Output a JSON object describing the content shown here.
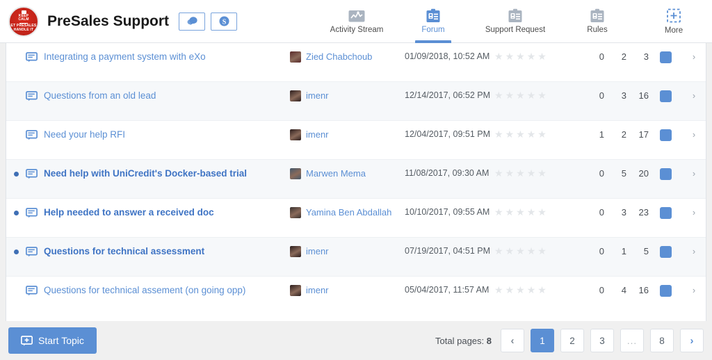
{
  "header": {
    "logo": {
      "line1": "KEEP",
      "line2": "CALM",
      "line3": "ET PRESALES",
      "line4": "HANDLE IT"
    },
    "title": "PreSales Support",
    "buttons": [
      {
        "name": "chat-button",
        "icon": "chat-bubble-icon"
      },
      {
        "name": "skype-button",
        "icon": "skype-icon"
      }
    ],
    "nav": [
      {
        "label": "Activity Stream",
        "icon": "activity-chart-icon",
        "active": false
      },
      {
        "label": "Forum",
        "icon": "clipboard-icon",
        "active": true
      },
      {
        "label": "Support Request",
        "icon": "clipboard-icon",
        "active": false
      },
      {
        "label": "Rules",
        "icon": "clipboard-icon",
        "active": false
      },
      {
        "label": "More",
        "icon": "plus-dashed-icon",
        "active": false
      }
    ]
  },
  "colors": {
    "accent": "#5b8fd4",
    "link": "#5b8fd4",
    "logo_red": "#c0241a",
    "star_empty": "#e3e6e9",
    "row_alt": "#f6f8fa",
    "footer_bg": "#f0f0f0"
  },
  "topics": [
    {
      "unread": false,
      "icon": "forum-topic-icon",
      "title": "Integrating a payment system with eXo",
      "author": "Zied Chabchoub",
      "avatar_color": "#5a2b2b",
      "date": "01/09/2018, 10:52 AM",
      "rating": 0,
      "stars": 5,
      "n1": "0",
      "n2": "2",
      "n3": "3"
    },
    {
      "unread": false,
      "icon": "forum-topic-icon",
      "title": "Questions from an old lead",
      "author": "imenr",
      "avatar_color": "#2b1d1d",
      "date": "12/14/2017, 06:52 PM",
      "rating": 0,
      "stars": 5,
      "n1": "0",
      "n2": "3",
      "n3": "16"
    },
    {
      "unread": false,
      "icon": "forum-topic-icon",
      "title": "Need your help RFI",
      "author": "imenr",
      "avatar_color": "#2b1d1d",
      "date": "12/04/2017, 09:51 PM",
      "rating": 0,
      "stars": 5,
      "n1": "1",
      "n2": "2",
      "n3": "17"
    },
    {
      "unread": true,
      "icon": "forum-topic-icon",
      "title": "Need help with UniCredit's Docker-based trial",
      "author": "Marwen Mema",
      "avatar_color": "#44586b",
      "date": "11/08/2017, 09:30 AM",
      "rating": 0,
      "stars": 5,
      "n1": "0",
      "n2": "5",
      "n3": "20"
    },
    {
      "unread": true,
      "icon": "forum-topic-icon",
      "title": "Help needed to answer a received doc",
      "author": "Yamina Ben Abdallah",
      "avatar_color": "#3a3330",
      "date": "10/10/2017, 09:55 AM",
      "rating": 0,
      "stars": 5,
      "n1": "0",
      "n2": "3",
      "n3": "23"
    },
    {
      "unread": true,
      "icon": "forum-topic-icon",
      "title": "Questions for technical assessment",
      "author": "imenr",
      "avatar_color": "#2b1d1d",
      "date": "07/19/2017, 04:51 PM",
      "rating": 0,
      "stars": 5,
      "n1": "0",
      "n2": "1",
      "n3": "5"
    },
    {
      "unread": false,
      "icon": "forum-topic-icon",
      "title": "Questions for technical assement (on going opp)",
      "author": "imenr",
      "avatar_color": "#2b1d1d",
      "date": "05/04/2017, 11:57 AM",
      "rating": 0,
      "stars": 5,
      "n1": "0",
      "n2": "4",
      "n3": "16"
    }
  ],
  "footer": {
    "start_topic_label": "Start Topic",
    "start_topic_icon": "add-topic-icon",
    "total_pages_label": "Total pages:",
    "total_pages_value": "8",
    "pages": [
      {
        "label": "‹",
        "type": "prev",
        "active": false
      },
      {
        "label": "1",
        "type": "page",
        "active": true
      },
      {
        "label": "2",
        "type": "page",
        "active": false
      },
      {
        "label": "3",
        "type": "page",
        "active": false
      },
      {
        "label": "...",
        "type": "dots",
        "active": false
      },
      {
        "label": "8",
        "type": "page",
        "active": false
      },
      {
        "label": "›",
        "type": "next",
        "active": false
      }
    ]
  }
}
